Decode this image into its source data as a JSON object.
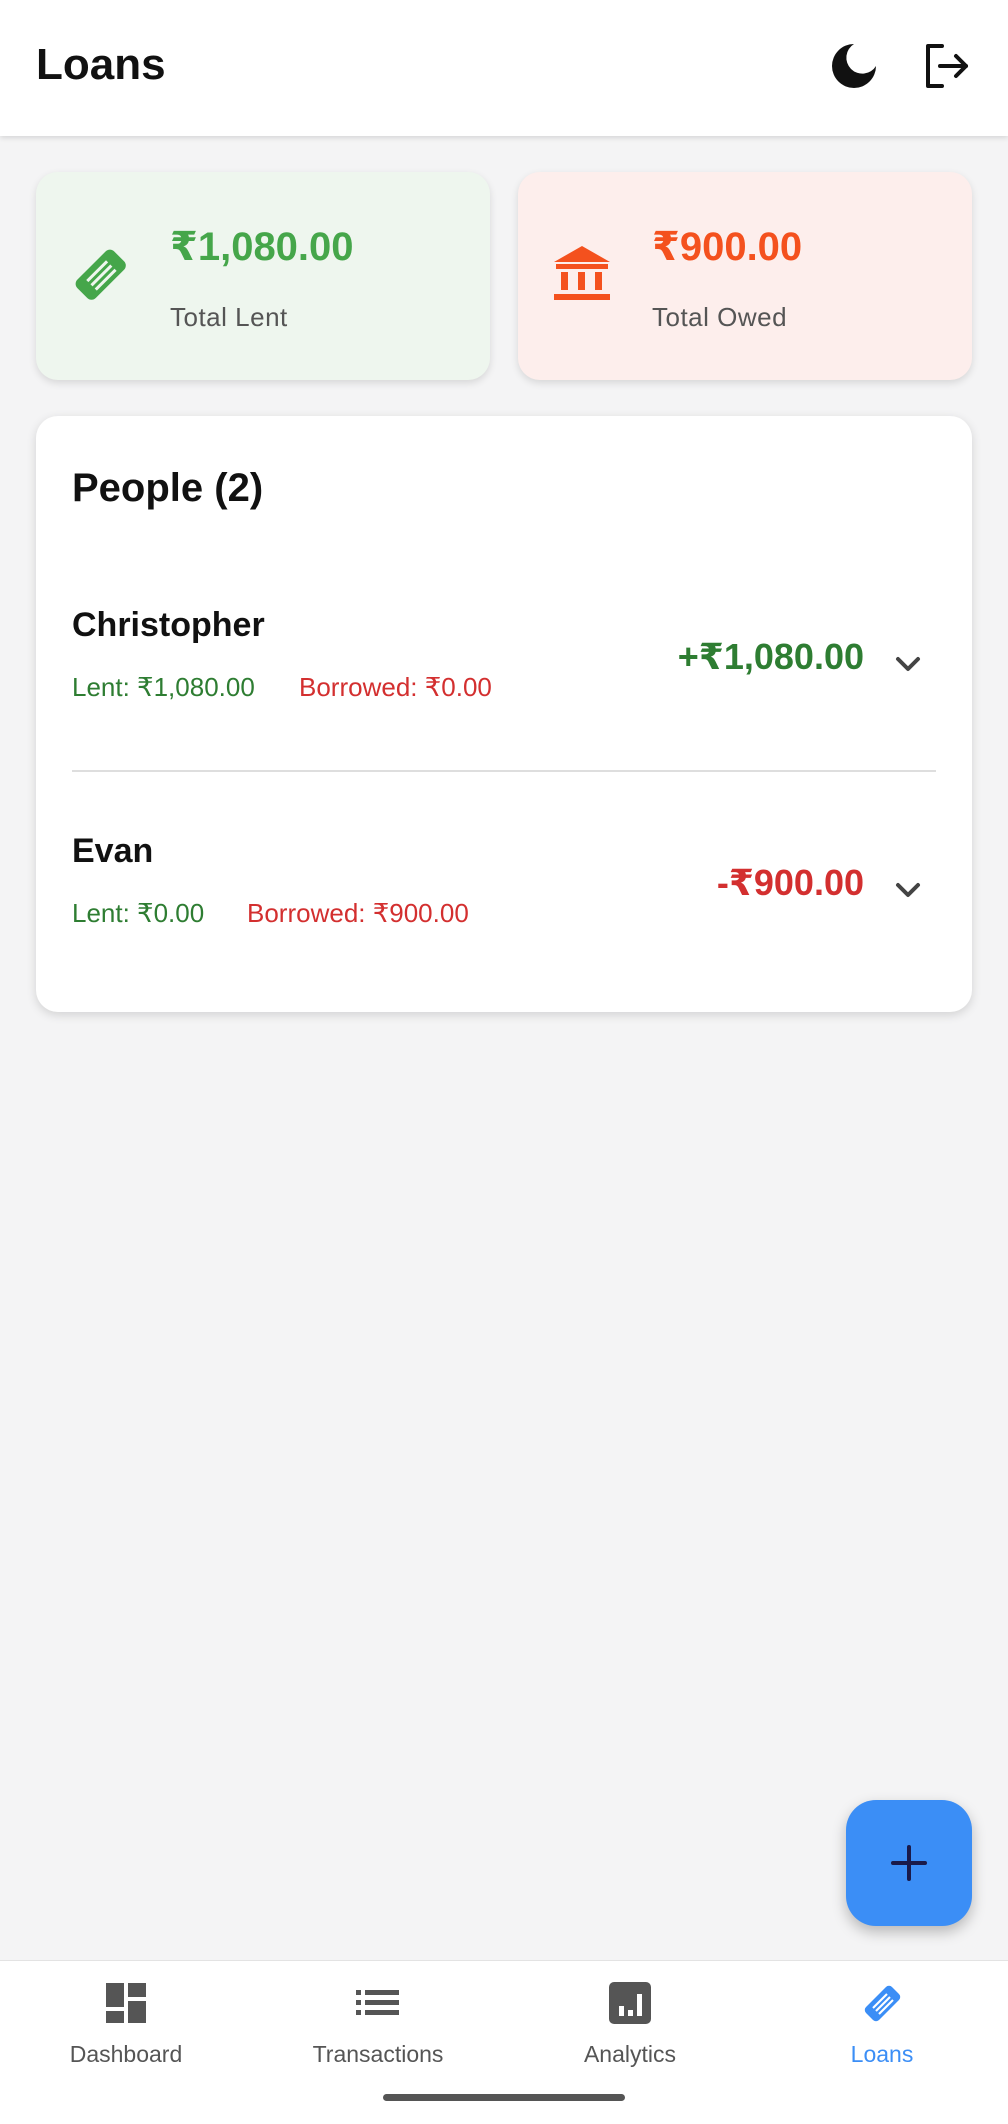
{
  "header": {
    "title": "Loans",
    "theme_icon": "moon-icon",
    "logout_icon": "logout-icon"
  },
  "summary": {
    "lent": {
      "amount": "₹1,080.00",
      "label": "Total Lent",
      "icon": "handshake-icon",
      "color": "#45a64a"
    },
    "owed": {
      "amount": "₹900.00",
      "label": "Total Owed",
      "icon": "bank-icon",
      "color": "#f4511e"
    }
  },
  "people": {
    "heading": "People (2)",
    "items": [
      {
        "name": "Christopher",
        "lent": "Lent: ₹1,080.00",
        "borrowed": "Borrowed: ₹0.00",
        "balance": "+₹1,080.00",
        "balance_color": "#2e7d32"
      },
      {
        "name": "Evan",
        "lent": "Lent: ₹0.00",
        "borrowed": "Borrowed: ₹900.00",
        "balance": "-₹900.00",
        "balance_color": "#d32f2f"
      }
    ]
  },
  "fab": {
    "icon": "plus-icon"
  },
  "bottom_nav": {
    "items": [
      {
        "label": "Dashboard",
        "icon": "dashboard-icon"
      },
      {
        "label": "Transactions",
        "icon": "list-icon"
      },
      {
        "label": "Analytics",
        "icon": "analytics-icon"
      },
      {
        "label": "Loans",
        "icon": "handshake-icon",
        "active": true
      }
    ],
    "active_color": "#3b8ef6"
  }
}
